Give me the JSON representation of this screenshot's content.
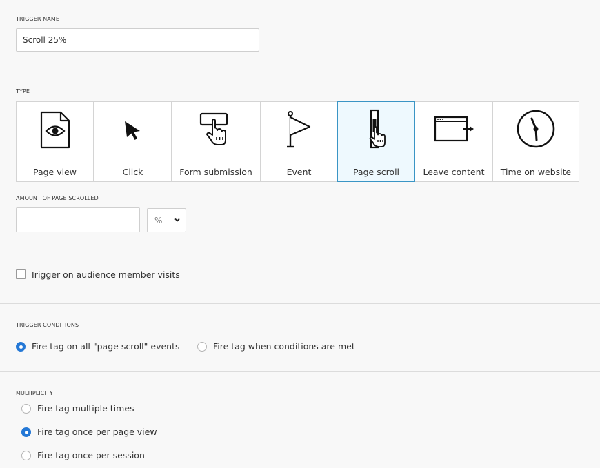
{
  "trigger_name": {
    "label": "TRIGGER NAME",
    "value": "Scroll 25%"
  },
  "type": {
    "label": "TYPE",
    "tiles": [
      {
        "label": "Page view",
        "icon": "page-view-icon"
      },
      {
        "label": "Click",
        "icon": "cursor-icon"
      },
      {
        "label": "Form submission",
        "icon": "form-submission-icon"
      },
      {
        "label": "Event",
        "icon": "flag-icon"
      },
      {
        "label": "Page scroll",
        "icon": "page-scroll-icon",
        "selected": true
      },
      {
        "label": "Leave content",
        "icon": "leave-content-icon"
      },
      {
        "label": "Time on website",
        "icon": "clock-icon"
      }
    ]
  },
  "amount": {
    "label": "AMOUNT OF PAGE SCROLLED",
    "value": "",
    "unit": "%"
  },
  "audience": {
    "label": "Trigger on audience member visits",
    "checked": false
  },
  "conditions": {
    "label": "TRIGGER CONDITIONS",
    "options": [
      {
        "label": "Fire tag on all \"page scroll\" events",
        "selected": true
      },
      {
        "label": "Fire tag when conditions are met",
        "selected": false
      }
    ]
  },
  "multiplicity": {
    "label": "MULTIPLICITY",
    "options": [
      {
        "label": "Fire tag multiple times",
        "selected": false
      },
      {
        "label": "Fire tag once per page view",
        "selected": true
      },
      {
        "label": "Fire tag once per session",
        "selected": false
      }
    ]
  },
  "colors": {
    "accent": "#2478d6",
    "selected_tile_bg": "#eef9fe",
    "selected_tile_border": "#3a95c5"
  }
}
